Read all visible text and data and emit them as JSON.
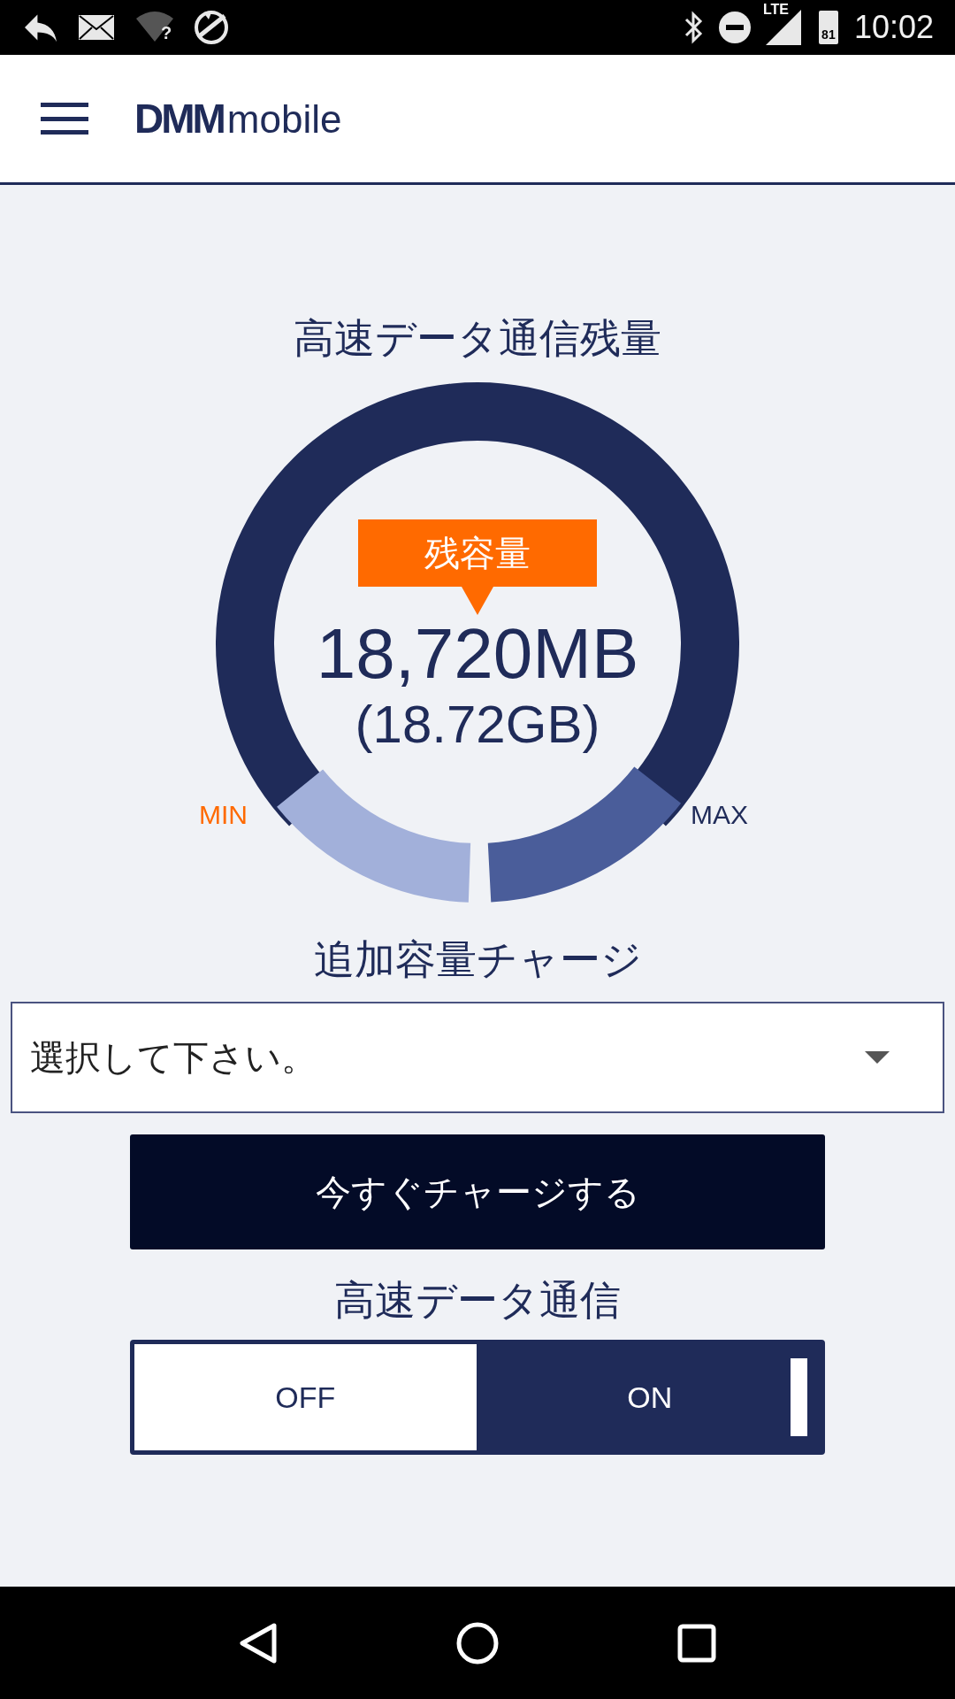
{
  "status_bar": {
    "wifi_mark": "?",
    "lte": "LTE",
    "battery": "81",
    "time": "10:02"
  },
  "header": {
    "logo_bold": "DMM",
    "logo_light": "mobile"
  },
  "remaining": {
    "title": "高速データ通信残量",
    "badge": "残容量",
    "amount": "18,720MB",
    "amount_gb": "(18.72GB)",
    "min_label": "MIN",
    "max_label": "MAX"
  },
  "charge": {
    "title": "追加容量チャージ",
    "select": {
      "placeholder": "選択して下さい。"
    },
    "button": "今すぐチャージする"
  },
  "high_speed": {
    "title": "高速データ通信",
    "options": [
      {
        "label": "OFF",
        "selected": false
      },
      {
        "label": "ON",
        "selected": true
      }
    ]
  }
}
